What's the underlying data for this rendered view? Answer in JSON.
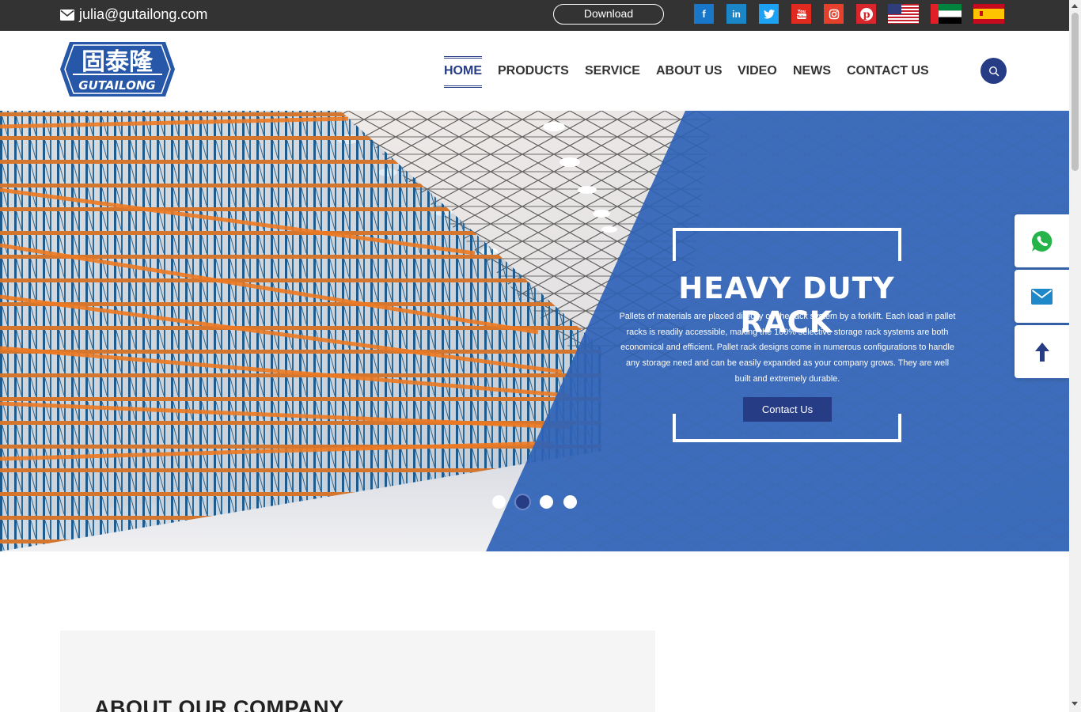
{
  "topbar": {
    "email": "julia@gutailong.com",
    "download_label": "Download",
    "social": [
      {
        "icon": "facebook-icon",
        "glyph": "f",
        "color": "#1877c8"
      },
      {
        "icon": "linkedin-icon",
        "glyph": "in",
        "color": "#1a86c8"
      },
      {
        "icon": "twitter-icon",
        "glyph": "t",
        "color": "#1da1f2"
      },
      {
        "icon": "youtube-icon",
        "glyph": "▶",
        "color": "#e02a20"
      },
      {
        "icon": "instagram-icon",
        "glyph": "◎",
        "color": "#e4402c"
      },
      {
        "icon": "pinterest-icon",
        "glyph": "p",
        "color": "#d8262c"
      }
    ],
    "flags": [
      "us-flag-icon",
      "uae-flag-icon",
      "spain-flag-icon"
    ]
  },
  "header": {
    "logo": {
      "chinese": "固泰隆",
      "brand": "GUTAILONG"
    },
    "nav": [
      "HOME",
      "PRODUCTS",
      "SERVICE",
      "ABOUT US",
      "VIDEO",
      "NEWS",
      "CONTACT US"
    ],
    "active_nav": "HOME"
  },
  "hero": {
    "title": "HEAVY DUTY RACK",
    "text": "Pallets of materials are placed directly on the rack system by a forklift. Each load in pallet racks is readily accessible, making the 100% selective storage rack systems are both economical and efficient. Pallet rack designs come in numerous configurations to handle any storage need and can be easily expanded as your company grows. They are well built and extremely durable.",
    "cta_label": "Contact Us",
    "slides_total": 4,
    "active_slide": 2
  },
  "side_buttons": [
    "whatsapp-icon",
    "email-icon",
    "back-to-top-icon"
  ],
  "about": {
    "title": "ABOUT OUR COMPANY"
  },
  "colors": {
    "brand_navy": "#263c85",
    "hero_blue": "#2f63b8",
    "topbar": "#333333",
    "rack_orange": "#ee7a22",
    "rack_blue": "#1f5a8c"
  }
}
